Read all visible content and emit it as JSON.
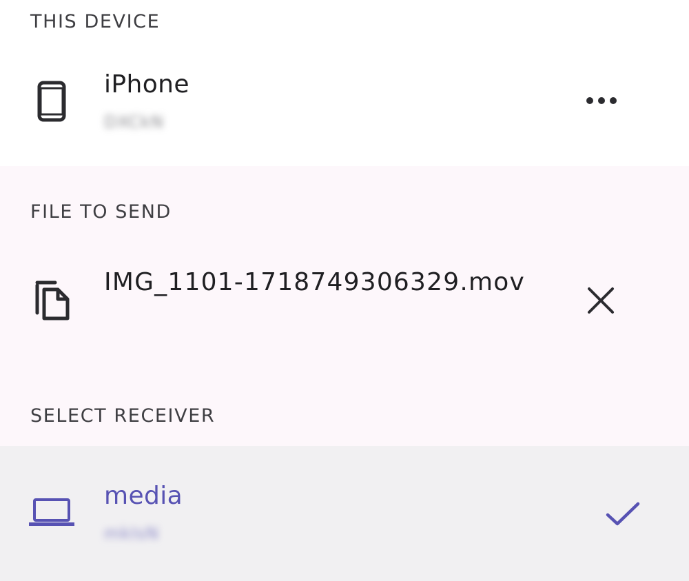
{
  "this_device": {
    "header": "THIS DEVICE",
    "name": "iPhone",
    "id": "DXCkN",
    "more_icon": "more-horizontal-icon",
    "device_icon": "smartphone-icon"
  },
  "file_to_send": {
    "header": "FILE TO SEND",
    "file_name": "IMG_1101-1718749306329.mov",
    "file_icon": "copy-files-icon",
    "remove_icon": "close-icon"
  },
  "select_receiver": {
    "header": "SELECT RECEIVER",
    "receivers": [
      {
        "name": "media",
        "id": "mkIsN",
        "selected": true,
        "icon": "laptop-icon"
      }
    ],
    "selected_icon": "checkmark-icon"
  },
  "colors": {
    "accent": "#5752b3",
    "text_primary": "#1f1f22",
    "header": "#3e3e42",
    "panel_white": "#ffffff",
    "panel_tint": "#fdf7fb",
    "selected_row": "#f1f0f2"
  }
}
